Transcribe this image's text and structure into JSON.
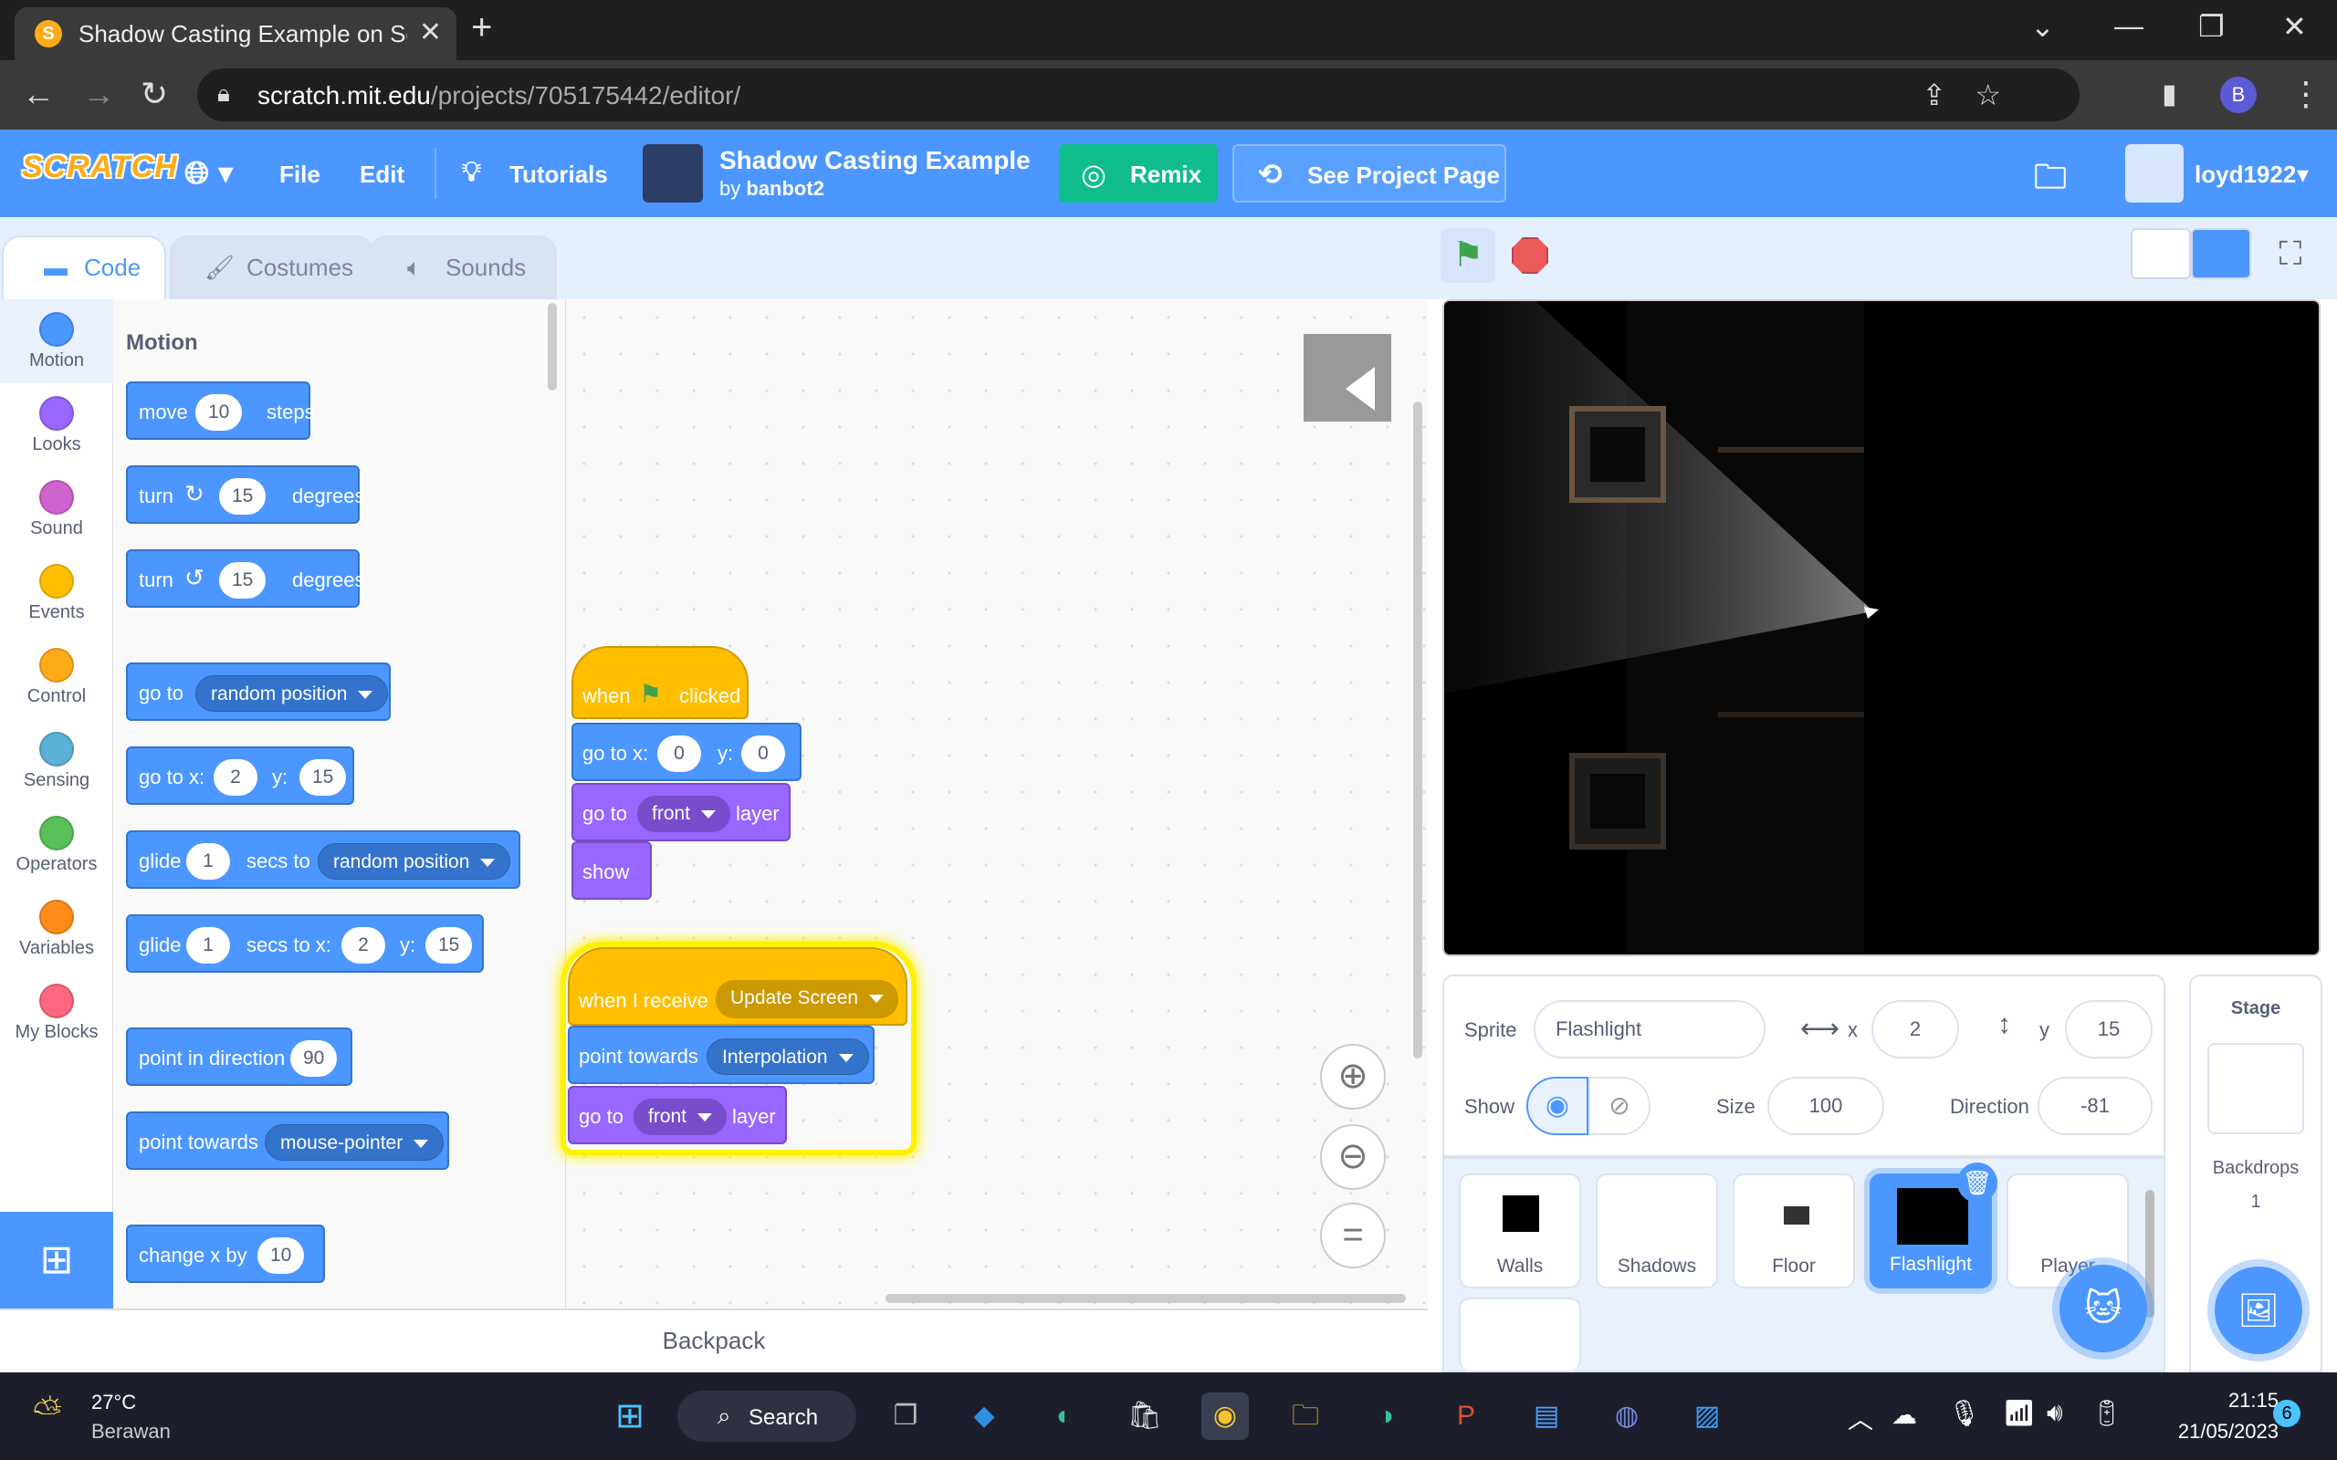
{
  "browser": {
    "tab_title": "Shadow Casting Example on Scra",
    "url_host": "scratch.mit.edu",
    "url_path": "/projects/705175442/editor/",
    "profile_initial": "B"
  },
  "menu": {
    "logo": "SCRATCH",
    "file": "File",
    "edit": "Edit",
    "tutorials": "Tutorials",
    "project_title": "Shadow Casting Example",
    "by": "by",
    "author": "banbot2",
    "remix": "Remix",
    "see_project": "See Project Page",
    "username": "loyd1922"
  },
  "editor_tabs": [
    "Code",
    "Costumes",
    "Sounds"
  ],
  "categories": [
    {
      "label": "Motion",
      "color": "#4c97ff"
    },
    {
      "label": "Looks",
      "color": "#9966ff"
    },
    {
      "label": "Sound",
      "color": "#cf63cf"
    },
    {
      "label": "Events",
      "color": "#ffbf00"
    },
    {
      "label": "Control",
      "color": "#ffab19"
    },
    {
      "label": "Sensing",
      "color": "#5cb1d6"
    },
    {
      "label": "Operators",
      "color": "#59c059"
    },
    {
      "label": "Variables",
      "color": "#ff8c1a"
    },
    {
      "label": "My Blocks",
      "color": "#ff6680"
    }
  ],
  "palette": {
    "title": "Motion",
    "move": {
      "a": "move",
      "v": "10",
      "b": "steps"
    },
    "turn_right": {
      "a": "turn",
      "v": "15",
      "b": "degrees"
    },
    "turn_left": {
      "a": "turn",
      "v": "15",
      "b": "degrees"
    },
    "go_to": {
      "a": "go to",
      "dd": "random position"
    },
    "go_to_xy": {
      "a": "go to x:",
      "x": "2",
      "b": "y:",
      "y": "15"
    },
    "glide_to": {
      "a": "glide",
      "v": "1",
      "b": "secs to",
      "dd": "random position"
    },
    "glide_xy": {
      "a": "glide",
      "v": "1",
      "b": "secs to x:",
      "x": "2",
      "c": "y:",
      "y": "15"
    },
    "point_dir": {
      "a": "point in direction",
      "v": "90"
    },
    "point_towards": {
      "a": "point towards",
      "dd": "mouse-pointer"
    },
    "change_x": {
      "a": "change x by",
      "v": "10"
    }
  },
  "script1": {
    "when": "when",
    "clicked": "clicked",
    "goto_a": "go to x:",
    "x": "0",
    "goto_b": "y:",
    "y": "0",
    "layer_a": "go to",
    "layer_dd": "front",
    "layer_b": "layer",
    "show": "show"
  },
  "script2": {
    "receive": "when I receive",
    "msg": "Update Screen",
    "point": "point towards",
    "target": "Interpolation",
    "layer_a": "go to",
    "layer_dd": "front",
    "layer_b": "layer"
  },
  "backpack": "Backpack",
  "sprite_info": {
    "sprite_label": "Sprite",
    "sprite_name": "Flashlight",
    "x_label": "x",
    "x": "2",
    "y_label": "y",
    "y": "15",
    "show_label": "Show",
    "size_label": "Size",
    "size": "100",
    "direction_label": "Direction",
    "direction": "-81"
  },
  "sprites": [
    "Walls",
    "Shadows",
    "Floor",
    "Flashlight",
    "Player"
  ],
  "stage_panel": {
    "title": "Stage",
    "backdrops_label": "Backdrops",
    "backdrops_count": "1"
  },
  "taskbar": {
    "temp": "27°C",
    "weather": "Berawan",
    "search": "Search",
    "time": "21:15",
    "date": "21/05/2023",
    "notif": "6"
  }
}
